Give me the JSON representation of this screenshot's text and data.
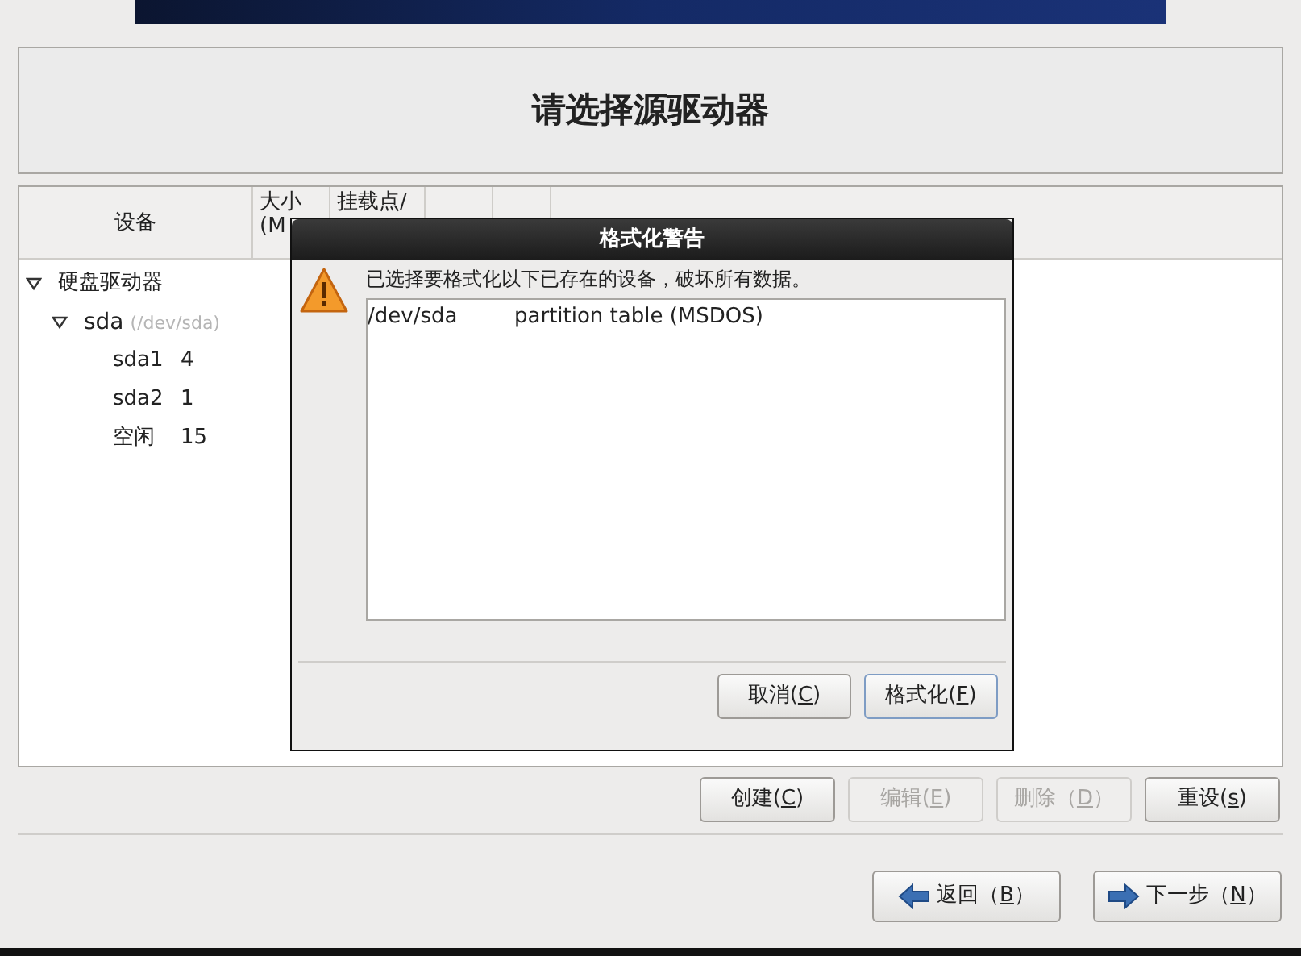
{
  "page_title": "请选择源驱动器",
  "table": {
    "columns": [
      "设备",
      "大小\n(M",
      "挂载点/"
    ],
    "tree": [
      {
        "label": "硬盘驱动器",
        "expanded": true,
        "children": [
          {
            "label": "sda",
            "path": "(/dev/sda)",
            "expanded": true,
            "children": [
              {
                "label": "sda1",
                "size": "4"
              },
              {
                "label": "sda2",
                "size": "1"
              },
              {
                "label": "空闲",
                "size": "15"
              }
            ]
          }
        ]
      }
    ]
  },
  "dialog": {
    "title": "格式化警告",
    "message": "已选择要格式化以下已存在的设备，破坏所有数据。",
    "items": [
      {
        "device": "/dev/sda",
        "description": "partition table (MSDOS)"
      }
    ],
    "buttons": [
      {
        "label": "取消(",
        "key": "C",
        "close": ")",
        "focused": false
      },
      {
        "label": "格式化(",
        "key": "F",
        "close": ")",
        "focused": true
      }
    ]
  },
  "actions": [
    {
      "label": "创建(",
      "key": "C",
      "close": ")",
      "disabled": false
    },
    {
      "label": "编辑(",
      "key": "E",
      "close": ")",
      "disabled": true
    },
    {
      "label": "删除（",
      "key": "D",
      "close": "）",
      "disabled": true
    },
    {
      "label": "重设(",
      "key": "s",
      "close": ")",
      "disabled": false
    }
  ],
  "nav": [
    {
      "label": "返回（",
      "key": "B",
      "close": "）",
      "kind": "back"
    },
    {
      "label": "下一步（",
      "key": "N",
      "close": "）",
      "kind": "next"
    }
  ]
}
